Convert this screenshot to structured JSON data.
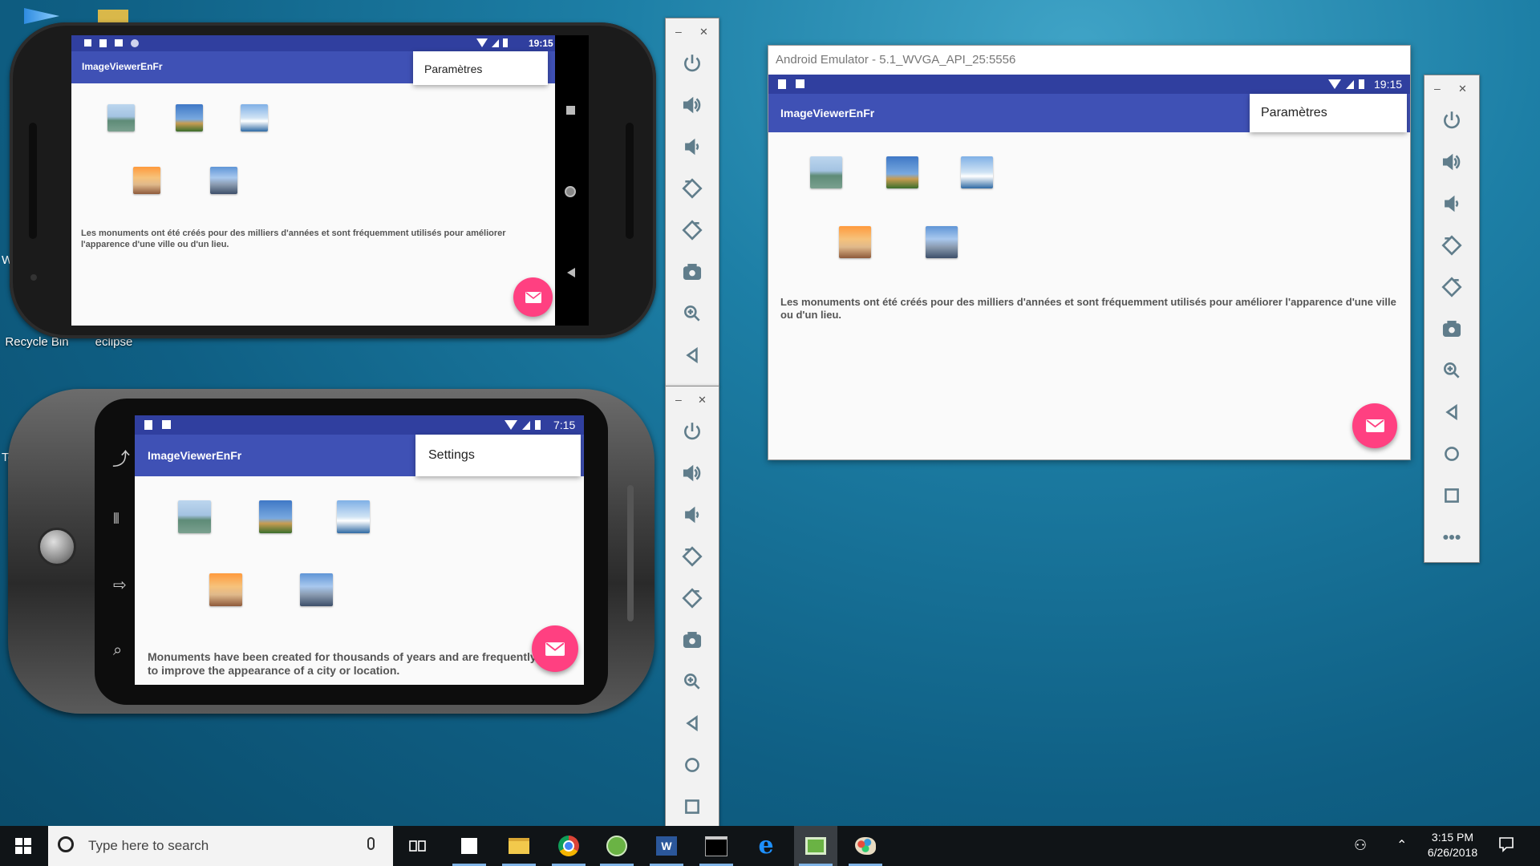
{
  "desktop": {
    "icons": [
      {
        "label": "Recycle Bin"
      },
      {
        "label": "eclipse"
      }
    ],
    "partial_labels": [
      "W",
      "Te"
    ]
  },
  "app": {
    "title": "ImageViewerEnFr",
    "body_fr": "Les monuments ont été créés pour des milliers d'années et sont fréquemment utilisés pour améliorer l'apparence d'une ville ou d'un lieu.",
    "body_en": "Monuments have been created for thousands of years and are frequently used to improve the appearance of a city or location.",
    "menu_fr": "Paramètres",
    "menu_en": "Settings",
    "images": [
      "statue-of-liberty",
      "eiffel-tower",
      "sydney-opera-house",
      "taj-mahal",
      "tower-bridge"
    ],
    "fab_icon": "mail-icon",
    "accent": "#3f51b5",
    "status_bar_color": "#303f9f",
    "fab_color": "#ff4081"
  },
  "emulator1": {
    "time": "19:15"
  },
  "emulator2": {
    "time": "7:15"
  },
  "emulator3": {
    "window_title": "Android Emulator - 5.1_WVGA_API_25:5556",
    "time": "19:15"
  },
  "emu_toolbar": {
    "minimize": "–",
    "close": "✕",
    "buttons": [
      "power-icon",
      "volume-up-icon",
      "volume-down-icon",
      "rotate-left-icon",
      "rotate-right-icon",
      "camera-icon",
      "zoom-icon",
      "back-icon",
      "home-icon",
      "overview-icon",
      "more-icon"
    ]
  },
  "taskbar": {
    "search_placeholder": "Type here to search",
    "apps": [
      "task-view-icon",
      "sticky-notes-icon",
      "file-explorer-icon",
      "chrome-icon",
      "android-studio-icon",
      "word-icon",
      "terminal-icon",
      "edge-icon",
      "emulator-icon",
      "paint-icon"
    ],
    "time": "3:15 PM",
    "date": "6/26/2018"
  }
}
